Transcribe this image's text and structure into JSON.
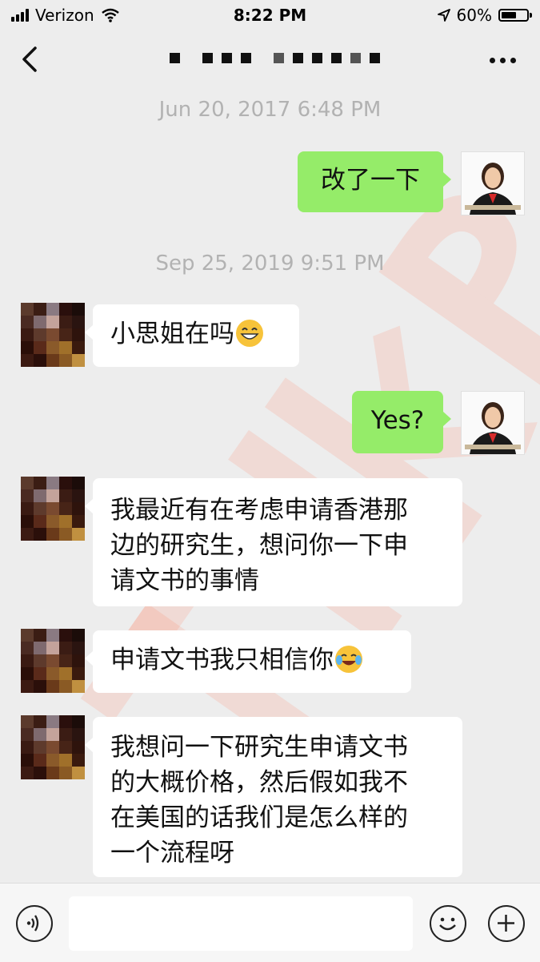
{
  "status": {
    "carrier": "Verizon",
    "time": "8:22 PM",
    "battery": "60%",
    "battery_level": 0.6
  },
  "nav": {
    "back_icon": "chevron-left-icon",
    "more_icon": "more-dots-icon"
  },
  "messages": [
    {
      "type": "timestamp",
      "text": "Jun 20, 2017 6:48 PM"
    },
    {
      "type": "out",
      "text": "改了一下"
    },
    {
      "type": "timestamp",
      "text": "Sep 25, 2019 9:51 PM"
    },
    {
      "type": "in",
      "text": "小思姐在吗",
      "emoji": "grinning-face-icon"
    },
    {
      "type": "out",
      "text": "Yes?"
    },
    {
      "type": "in",
      "lines": [
        "我最近有在考虑申请香港那",
        "边的研究生，想问你一下申",
        "请文书的事情"
      ]
    },
    {
      "type": "in",
      "text": "申请文书我只相信你",
      "emoji": "crying-laughing-icon"
    },
    {
      "type": "in",
      "lines": [
        "我想问一下研究生申请文书",
        "的大概价格，然后假如我不",
        "在美国的话我们是怎么样的",
        "一个流程呀"
      ]
    }
  ],
  "watermark": "TalkPro",
  "input_bar": {
    "voice_icon": "voice-icon",
    "emoji_icon": "emoji-icon",
    "plus_icon": "plus-icon"
  },
  "colors": {
    "background": "#ededed",
    "outgoing_bubble": "#95ec69",
    "incoming_bubble": "#ffffff"
  }
}
